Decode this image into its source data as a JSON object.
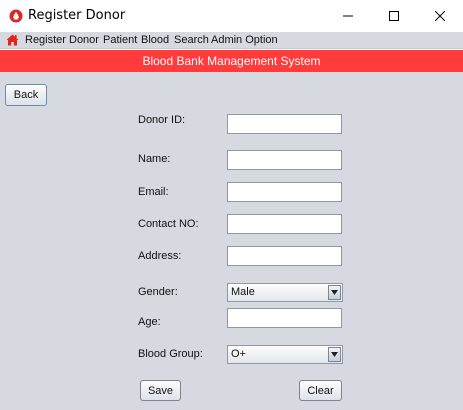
{
  "window": {
    "title": "Register Donor"
  },
  "menu": {
    "items": [
      "Register",
      "Donor",
      "Patient",
      "Blood",
      "Search",
      "Admin Option"
    ]
  },
  "banner": {
    "text": "Blood Bank Management System"
  },
  "buttons": {
    "back": "Back",
    "save": "Save",
    "clear": "Clear"
  },
  "form": {
    "donor_id": {
      "label": "Donor ID:",
      "value": ""
    },
    "name": {
      "label": "Name:",
      "value": ""
    },
    "email": {
      "label": "Email:",
      "value": ""
    },
    "contact": {
      "label": "Contact NO:",
      "value": ""
    },
    "address": {
      "label": "Address:",
      "value": ""
    },
    "gender": {
      "label": "Gender:",
      "selected": "Male"
    },
    "age": {
      "label": "Age:",
      "value": ""
    },
    "blood_group": {
      "label": "Blood Group:",
      "selected": "O+"
    }
  },
  "colors": {
    "banner": "#ff3b3b",
    "panel": "#d6d9df",
    "app_icon": "#d8282b"
  },
  "icons": {
    "app": "blood-drop-icon",
    "home": "home-icon"
  }
}
